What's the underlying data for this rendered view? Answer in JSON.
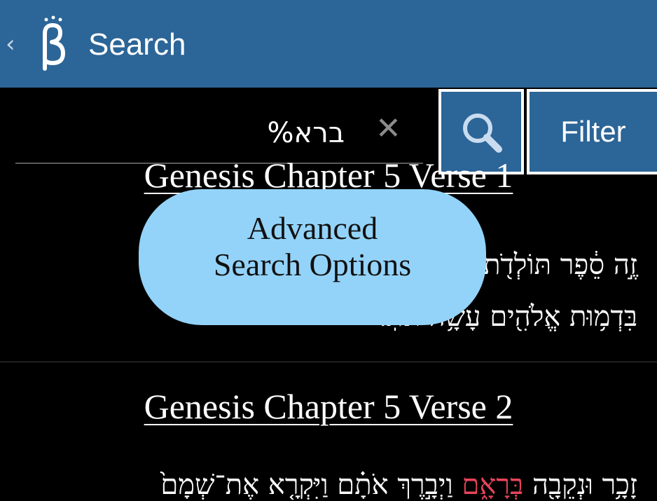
{
  "header": {
    "back_label": "‹",
    "title": "Search",
    "logo_icon": "beta-logo-icon"
  },
  "search": {
    "value": "ברא%",
    "clear_icon": "✕",
    "search_icon": "magnifier-icon",
    "filter_label": "Filter"
  },
  "results": [
    {
      "heading": "Genesis Chapter 5 Verse 1",
      "line1": "זֶ֣ה סֵ֔פֶר תּוֹלְדֹ֖ת אָדָ֑ם בְּי֗וֹם בְּרֹ֤א אֱלֹהִים֙ אָדָ֔ם",
      "line2": "בִּדְמ֥וּת אֱלֹהִ֖ים עָשָׂ֥ה אֹתֽוֹ׃"
    },
    {
      "heading": "Genesis Chapter 5 Verse 2",
      "line1_pre": "זָכָ֥ר וּנְקֵבָ֖ה ",
      "line1_hl": "בְּרָאָ֑ם",
      "line1_post": " וַיְבָ֣רֶךְ אֹתָ֗ם וַיִּקְרָ֤א אֶת־שְׁמָם֙"
    }
  ],
  "advanced": {
    "line1": "Advanced",
    "line2": "Search Options"
  },
  "colors": {
    "header_bg": "#2c6597",
    "button_bg": "#2c6597",
    "popup_bg": "#93d3f9",
    "highlight": "#e8455b"
  }
}
